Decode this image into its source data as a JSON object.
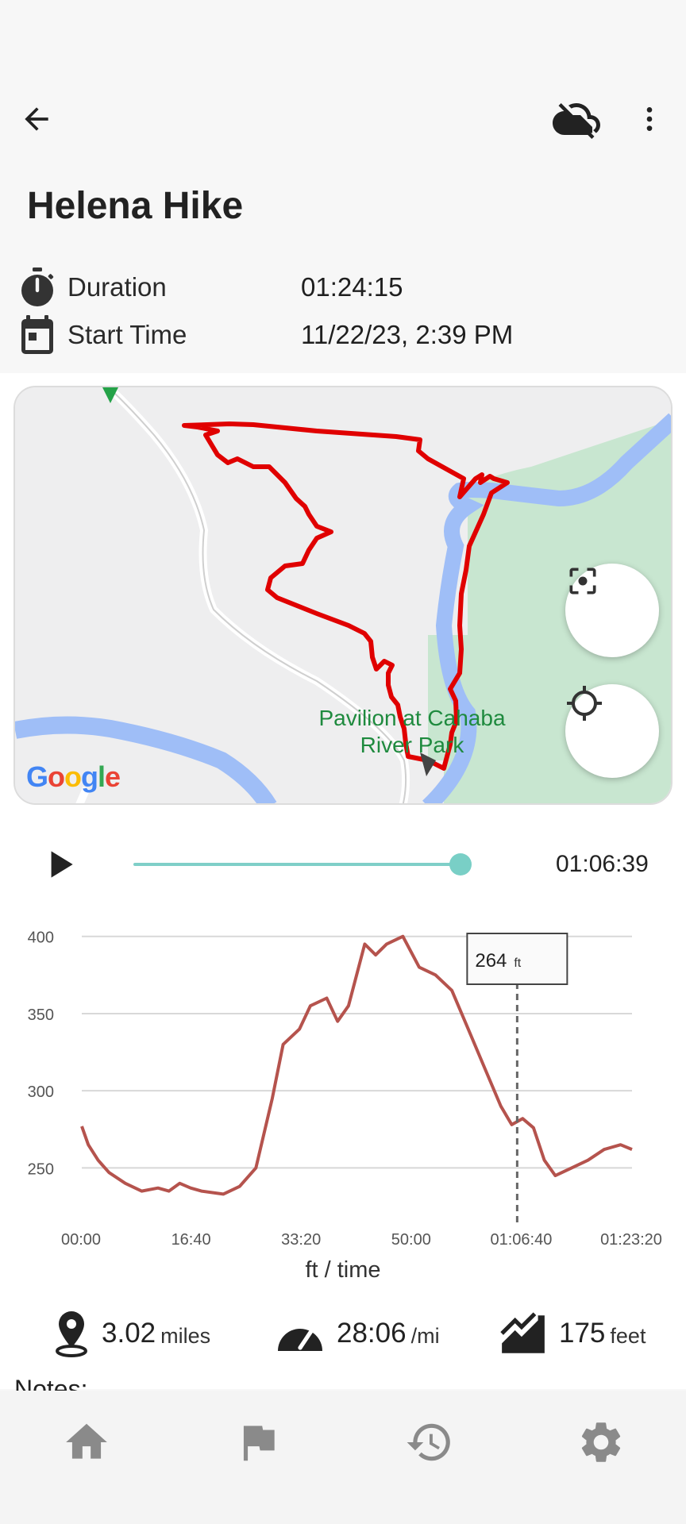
{
  "header": {
    "title": "Helena Hike"
  },
  "info": {
    "duration_label": "Duration",
    "duration_value": "01:24:15",
    "start_label": "Start Time",
    "start_value": "11/22/23, 2:39 PM"
  },
  "map": {
    "poi_label_line1": "Pavilion at Cahaba",
    "poi_label_line2": "River Park",
    "attribution": "Google",
    "colors": {
      "route": "#e00000",
      "river": "#9fbef7",
      "park": "#c8e6d0",
      "road": "#ffffff"
    }
  },
  "player": {
    "time": "01:06:39",
    "progress": 0.79
  },
  "chart_data": {
    "type": "line",
    "title": "",
    "xlabel": "ft / time",
    "ylabel": "",
    "x_ticks": [
      "00:00",
      "16:40",
      "33:20",
      "50:00",
      "01:06:40",
      "01:23:20"
    ],
    "y_ticks": [
      250,
      300,
      350,
      400
    ],
    "ylim": [
      225,
      405
    ],
    "xlim_seconds": [
      0,
      5055
    ],
    "series": [
      {
        "name": "",
        "x_seconds": [
          0,
          60,
          150,
          250,
          400,
          550,
          700,
          800,
          900,
          1000,
          1100,
          1300,
          1450,
          1600,
          1750,
          1850,
          2000,
          2100,
          2250,
          2350,
          2450,
          2600,
          2700,
          2800,
          2950,
          3100,
          3250,
          3400,
          3550,
          3700,
          3850,
          3950,
          4050,
          4150,
          4250,
          4350,
          4500,
          4650,
          4800,
          4950,
          5055
        ],
        "values": [
          277,
          265,
          255,
          247,
          240,
          235,
          237,
          235,
          240,
          237,
          235,
          233,
          238,
          250,
          295,
          330,
          340,
          355,
          360,
          345,
          355,
          395,
          388,
          395,
          400,
          380,
          375,
          365,
          340,
          315,
          290,
          278,
          282,
          276,
          255,
          245,
          250,
          255,
          262,
          265,
          262
        ]
      }
    ],
    "marker": {
      "x_seconds": 4000,
      "label_value": "264",
      "label_unit": "ft"
    },
    "colors": {
      "line": "#b5534d",
      "grid": "#d8d8d8",
      "marker": "#666666"
    }
  },
  "stats": {
    "distance_value": "3.02",
    "distance_unit": "miles",
    "pace_value": "28:06",
    "pace_unit": "/mi",
    "elevation_value": "175",
    "elevation_unit": "feet"
  },
  "notes_label": "Notes:",
  "icons": {
    "back": "arrow-back-icon",
    "cloud": "cloud-off-icon",
    "more": "more-vert-icon",
    "timer": "timer-icon",
    "calendar": "calendar-icon",
    "center_focus": "center-focus-icon",
    "my_location": "my-location-icon",
    "play": "play-icon",
    "location": "location-pin-icon",
    "speed": "speedometer-icon",
    "elevation": "elevation-icon",
    "home": "home-icon",
    "flag": "flag-icon",
    "history": "history-icon",
    "settings": "settings-icon"
  }
}
